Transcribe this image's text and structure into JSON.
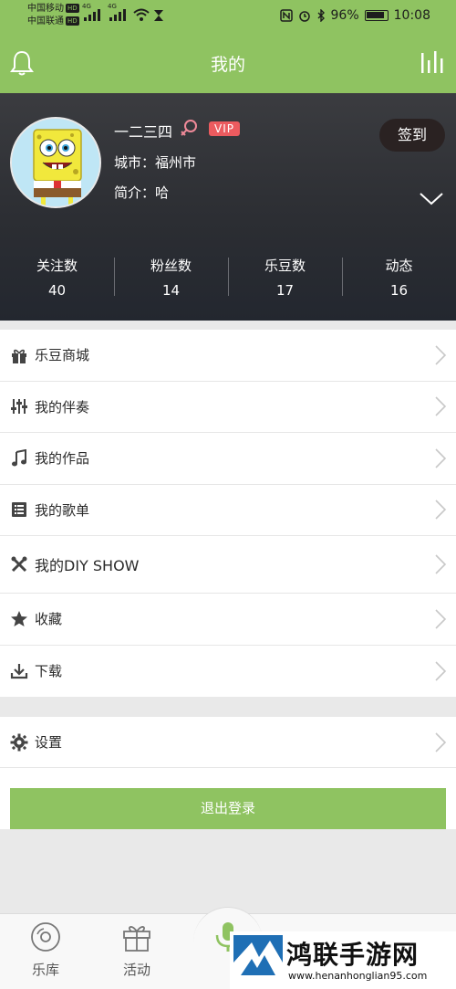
{
  "status_bar": {
    "carrier_1": "中国移动",
    "carrier_2": "中国联通",
    "hd_badge": "HD",
    "network_1": "4G",
    "network_2": "4G",
    "battery": "96%",
    "time": "10:08"
  },
  "header": {
    "title": "我的",
    "left_icon": "bell-icon",
    "right_icon": "bar-chart-icon",
    "color": "#8fc361"
  },
  "profile": {
    "username": "一二三四",
    "vip_badge": "VIP",
    "city": "城市：福州市",
    "intro": "简介：哈",
    "signin_label": "签到",
    "stats": [
      {
        "label": "关注数",
        "value": "40"
      },
      {
        "label": "粉丝数",
        "value": "14"
      },
      {
        "label": "乐豆数",
        "value": "17"
      },
      {
        "label": "动态",
        "value": "16"
      }
    ]
  },
  "menu": {
    "items": [
      {
        "label": "乐豆商城",
        "icon": "gift-icon"
      },
      {
        "label": "我的伴奏",
        "icon": "sliders-icon"
      },
      {
        "label": "我的作品",
        "icon": "music-note-icon"
      },
      {
        "label": "我的歌单",
        "icon": "list-icon"
      },
      {
        "label": "我的DIY SHOW",
        "icon": "tools-icon"
      },
      {
        "label": "收藏",
        "icon": "star-icon"
      },
      {
        "label": "下载",
        "icon": "download-icon"
      }
    ],
    "settings_label": "设置",
    "logout_label": "退出登录"
  },
  "tabbar": {
    "tabs": [
      {
        "label": "乐库",
        "icon": "disc-icon"
      },
      {
        "label": "活动",
        "icon": "gift-icon"
      }
    ]
  },
  "watermark": {
    "title": "鸿联手游网",
    "url": "www.henanhonglian95.com"
  },
  "colors": {
    "accent": "#8fc361",
    "vip": "#ec5b5f",
    "profile_bg": "#2c2e33"
  }
}
